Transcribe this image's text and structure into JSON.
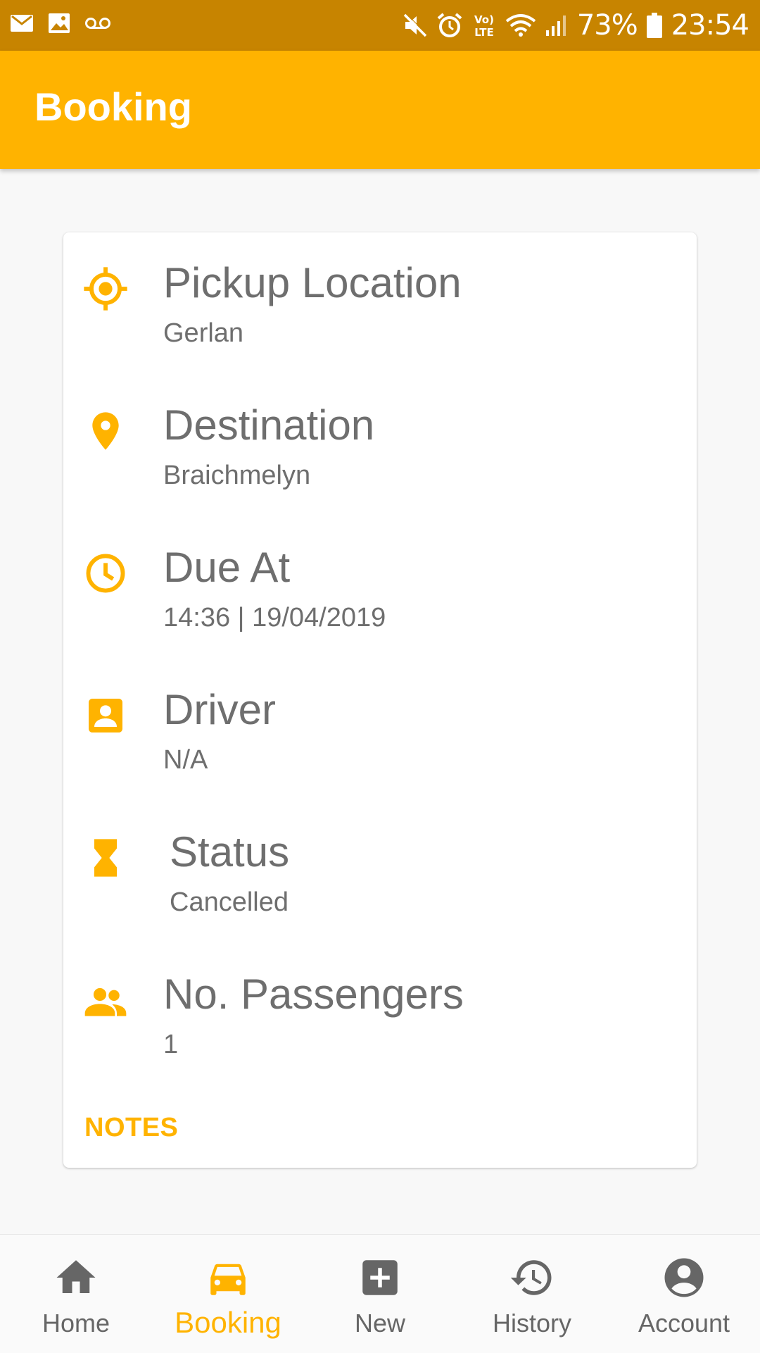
{
  "status_bar": {
    "battery": "73%",
    "time": "23:54",
    "network": "VoLTE"
  },
  "app_bar": {
    "title": "Booking"
  },
  "booking": {
    "rows": [
      {
        "label": "Pickup Location",
        "value": "Gerlan",
        "icon": "crosshair-icon"
      },
      {
        "label": "Destination",
        "value": "Braichmelyn",
        "icon": "location-pin-icon"
      },
      {
        "label": "Due At",
        "value": "14:36 | 19/04/2019",
        "icon": "clock-icon"
      },
      {
        "label": "Driver",
        "value": "N/A",
        "icon": "contact-icon"
      },
      {
        "label": "Status",
        "value": "Cancelled",
        "icon": "hourglass-icon"
      },
      {
        "label": "No. Passengers",
        "value": "1",
        "icon": "people-icon"
      }
    ],
    "notes_label": "NOTES"
  },
  "bottom_nav": {
    "items": [
      {
        "label": "Home",
        "icon": "home-icon",
        "active": false
      },
      {
        "label": "Booking",
        "icon": "car-icon",
        "active": true
      },
      {
        "label": "New",
        "icon": "add-box-icon",
        "active": false
      },
      {
        "label": "History",
        "icon": "history-icon",
        "active": false
      },
      {
        "label": "Account",
        "icon": "account-circle-icon",
        "active": false
      }
    ]
  },
  "colors": {
    "accent": "#ffb300",
    "status_bar": "#c78400",
    "text": "#6e6e6e",
    "nav_inactive": "#666666"
  }
}
